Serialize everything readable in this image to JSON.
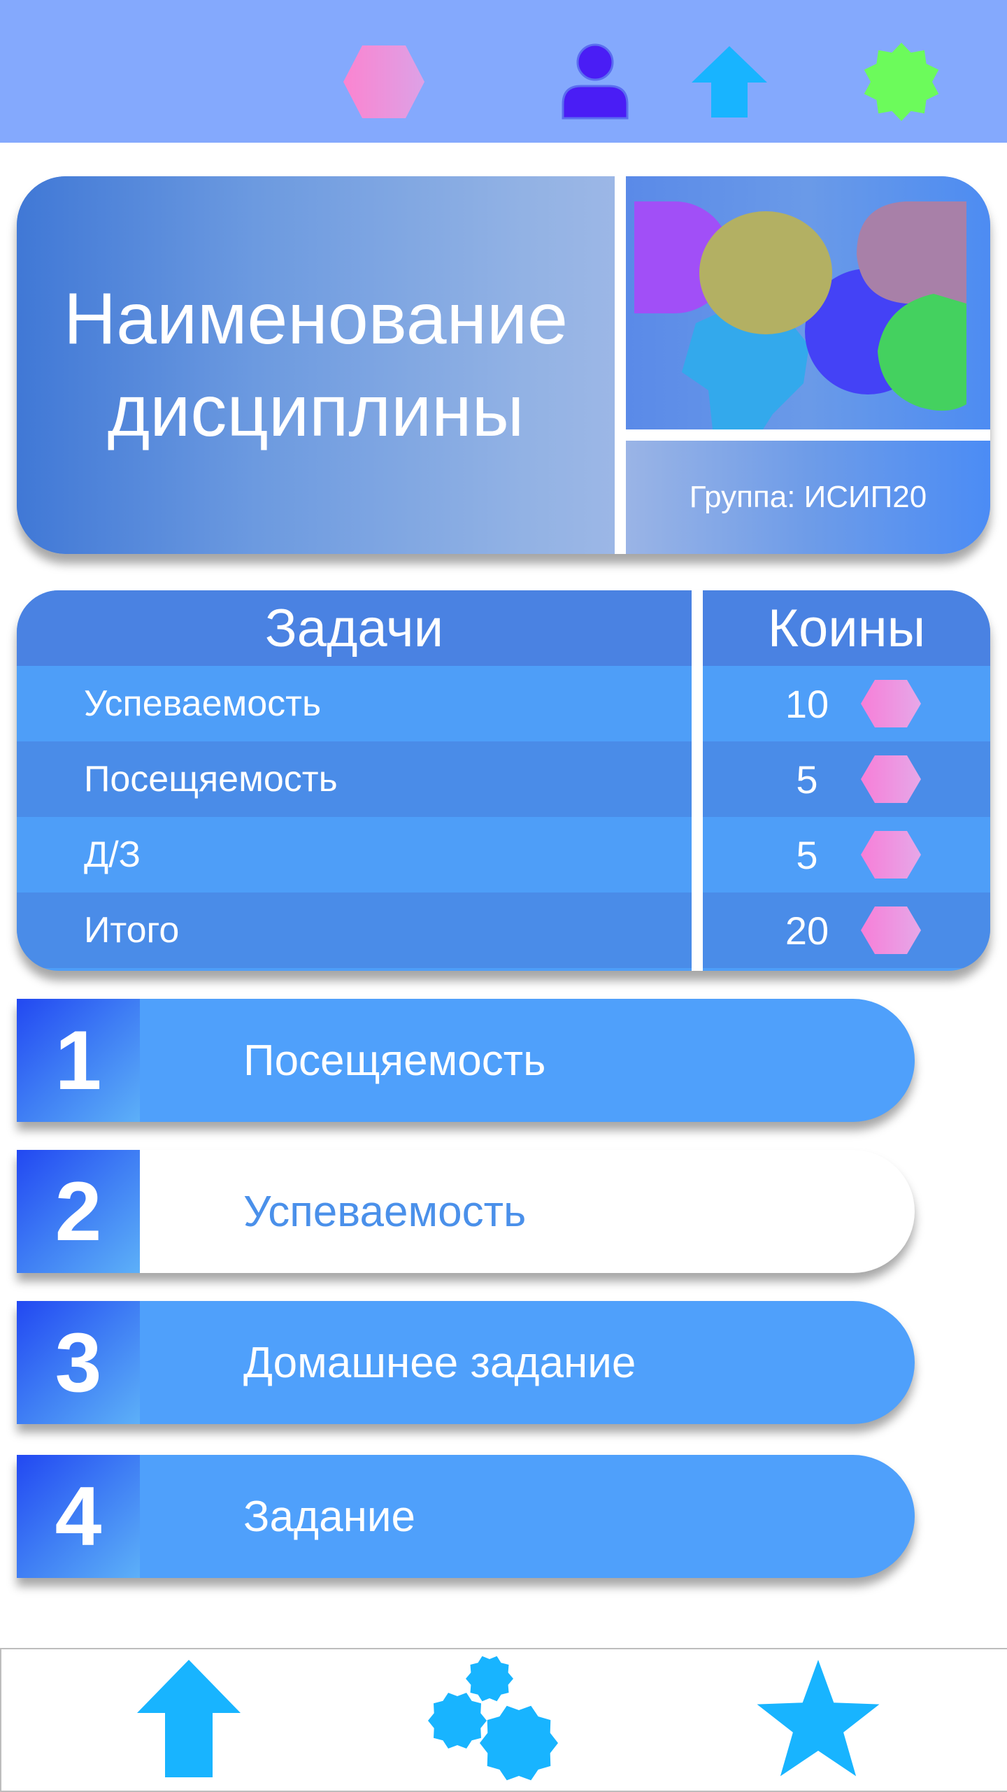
{
  "top_nav": {
    "icons": [
      "coin-hexagon-icon",
      "user-icon",
      "upload-arrow-icon",
      "badge-star-icon"
    ]
  },
  "subject": {
    "title_line1": "Наименование",
    "title_line2": "дисциплины",
    "group_label": "Группа: ИСИП20"
  },
  "coins_table": {
    "header_tasks": "Задачи",
    "header_coins": "Коины",
    "rows": [
      {
        "label": "Успеваемость",
        "value": "10"
      },
      {
        "label": "Посещяемость",
        "value": "5"
      },
      {
        "label": "Д/З",
        "value": "5"
      },
      {
        "label": "Итого",
        "value": "20"
      }
    ]
  },
  "tasks": [
    {
      "number": "1",
      "label": "Посещяемость"
    },
    {
      "number": "2",
      "label": "Успеваемость"
    },
    {
      "number": "3",
      "label": "Домашнее задание"
    },
    {
      "number": "4",
      "label": "Задание"
    }
  ],
  "bottom_nav": {
    "icons": [
      "upload-arrow-icon",
      "cluster-badges-icon",
      "star-icon"
    ]
  },
  "colors": {
    "topbar": "#84a9fd",
    "accent_blue": "#4fa0fb",
    "coin_pink": "#f07fd8",
    "icon_cyan": "#18b4ff"
  }
}
